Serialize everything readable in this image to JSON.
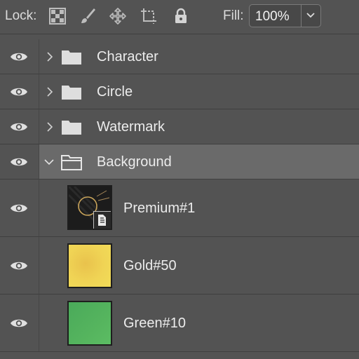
{
  "lock_bar": {
    "label": "Lock:",
    "icons": [
      "lock-transparent-pixels-icon",
      "lock-image-pixels-icon",
      "lock-position-icon",
      "lock-artboard-icon",
      "lock-all-icon"
    ],
    "fill_label": "Fill:",
    "fill_value": "100%"
  },
  "layers": [
    {
      "name": "Character",
      "type": "group",
      "expanded": false,
      "visible": true,
      "selected": false
    },
    {
      "name": "Circle",
      "type": "group",
      "expanded": false,
      "visible": true,
      "selected": false
    },
    {
      "name": "Watermark",
      "type": "group",
      "expanded": false,
      "visible": true,
      "selected": false
    },
    {
      "name": "Background",
      "type": "group",
      "expanded": true,
      "visible": true,
      "selected": true
    },
    {
      "name": "Premium#1",
      "type": "smart-object",
      "visible": true,
      "thumbnail": "dark-ring"
    },
    {
      "name": "Gold#50",
      "type": "layer",
      "visible": true,
      "thumbnail_color": "#f0d455"
    },
    {
      "name": "Green#10",
      "type": "layer",
      "visible": true,
      "thumbnail_color": "#55b45e"
    }
  ],
  "colors": {
    "panel_bg": "#535353",
    "selected_row": "#6a6a6a",
    "text": "#ececec"
  }
}
